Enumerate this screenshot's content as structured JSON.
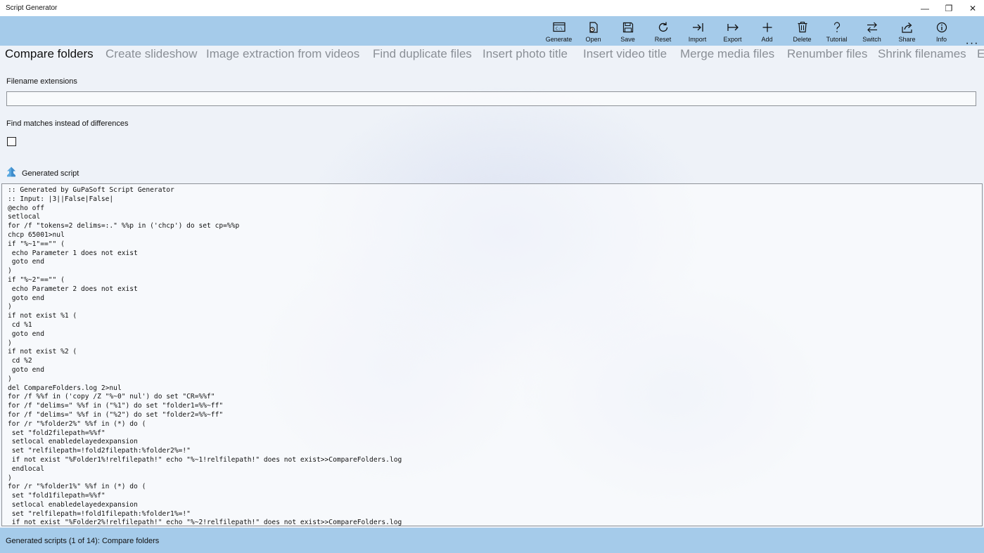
{
  "window": {
    "title": "Script Generator",
    "controls": {
      "minimize": "—",
      "maximize": "❐",
      "close": "✕"
    }
  },
  "toolbar": {
    "buttons": [
      {
        "label": "Generate",
        "icon": "generate-icon"
      },
      {
        "label": "Open",
        "icon": "open-icon"
      },
      {
        "label": "Save",
        "icon": "save-icon"
      },
      {
        "label": "Reset",
        "icon": "reset-icon"
      },
      {
        "label": "Import",
        "icon": "import-icon"
      },
      {
        "label": "Export",
        "icon": "export-icon"
      },
      {
        "label": "Add",
        "icon": "add-icon"
      },
      {
        "label": "Delete",
        "icon": "delete-icon"
      },
      {
        "label": "Tutorial",
        "icon": "tutorial-icon"
      },
      {
        "label": "Switch",
        "icon": "switch-icon"
      },
      {
        "label": "Share",
        "icon": "share-icon"
      },
      {
        "label": "Info",
        "icon": "info-icon"
      }
    ],
    "more": "···"
  },
  "tabs": [
    {
      "label": "Compare folders",
      "active": true
    },
    {
      "label": "Create slideshow"
    },
    {
      "label": "Image extraction from videos"
    },
    {
      "label": "Find duplicate files"
    },
    {
      "label": "Insert photo title"
    },
    {
      "label": "Insert video title"
    },
    {
      "label": "Merge media files"
    },
    {
      "label": "Renumber files"
    },
    {
      "label": "Shrink filenames"
    },
    {
      "label": "E"
    }
  ],
  "form": {
    "extensions_label": "Filename extensions",
    "extensions_value": "",
    "matches_label": "Find matches instead of differences",
    "matches_checked": false
  },
  "generated": {
    "label": "Generated script",
    "script": ":: Generated by GuPaSoft Script Generator\n:: Input: |3||False|False|\n@echo off\nsetlocal\nfor /f \"tokens=2 delims=:.\" %%p in ('chcp') do set cp=%%p\nchcp 65001>nul\nif \"%~1\"==\"\" (\n echo Parameter 1 does not exist\n goto end\n)\nif \"%~2\"==\"\" (\n echo Parameter 2 does not exist\n goto end\n)\nif not exist %1 (\n cd %1\n goto end\n)\nif not exist %2 (\n cd %2\n goto end\n)\ndel CompareFolders.log 2>nul\nfor /f %%f in ('copy /Z \"%~0\" nul') do set \"CR=%%f\"\nfor /f \"delims=\" %%f in (\"%1\") do set \"folder1=%%~ff\"\nfor /f \"delims=\" %%f in (\"%2\") do set \"folder2=%%~ff\"\nfor /r \"%folder2%\" %%f in (*) do (\n set \"fold2filepath=%%f\"\n setlocal enabledelayedexpansion\n set \"relfilepath=!fold2filepath:%folder2%=!\"\n if not exist \"%Folder1%!relfilepath!\" echo \"%~1!relfilepath!\" does not exist>>CompareFolders.log\n endlocal\n)\nfor /r \"%folder1%\" %%f in (*) do (\n set \"fold1filepath=%%f\"\n setlocal enabledelayedexpansion\n set \"relfilepath=!fold1filepath:%folder1%=!\"\n if not exist \"%Folder2%!relfilepath!\" echo \"%~2!relfilepath!\" does not exist>>CompareFolders.log"
  },
  "status": {
    "text": "Generated scripts (1 of 14): Compare folders"
  },
  "colors": {
    "accent_bar": "#a5cbea",
    "background": "#eef2f8",
    "tab_inactive": "#8a8f96",
    "generated_icon": "#5aa8e0"
  }
}
